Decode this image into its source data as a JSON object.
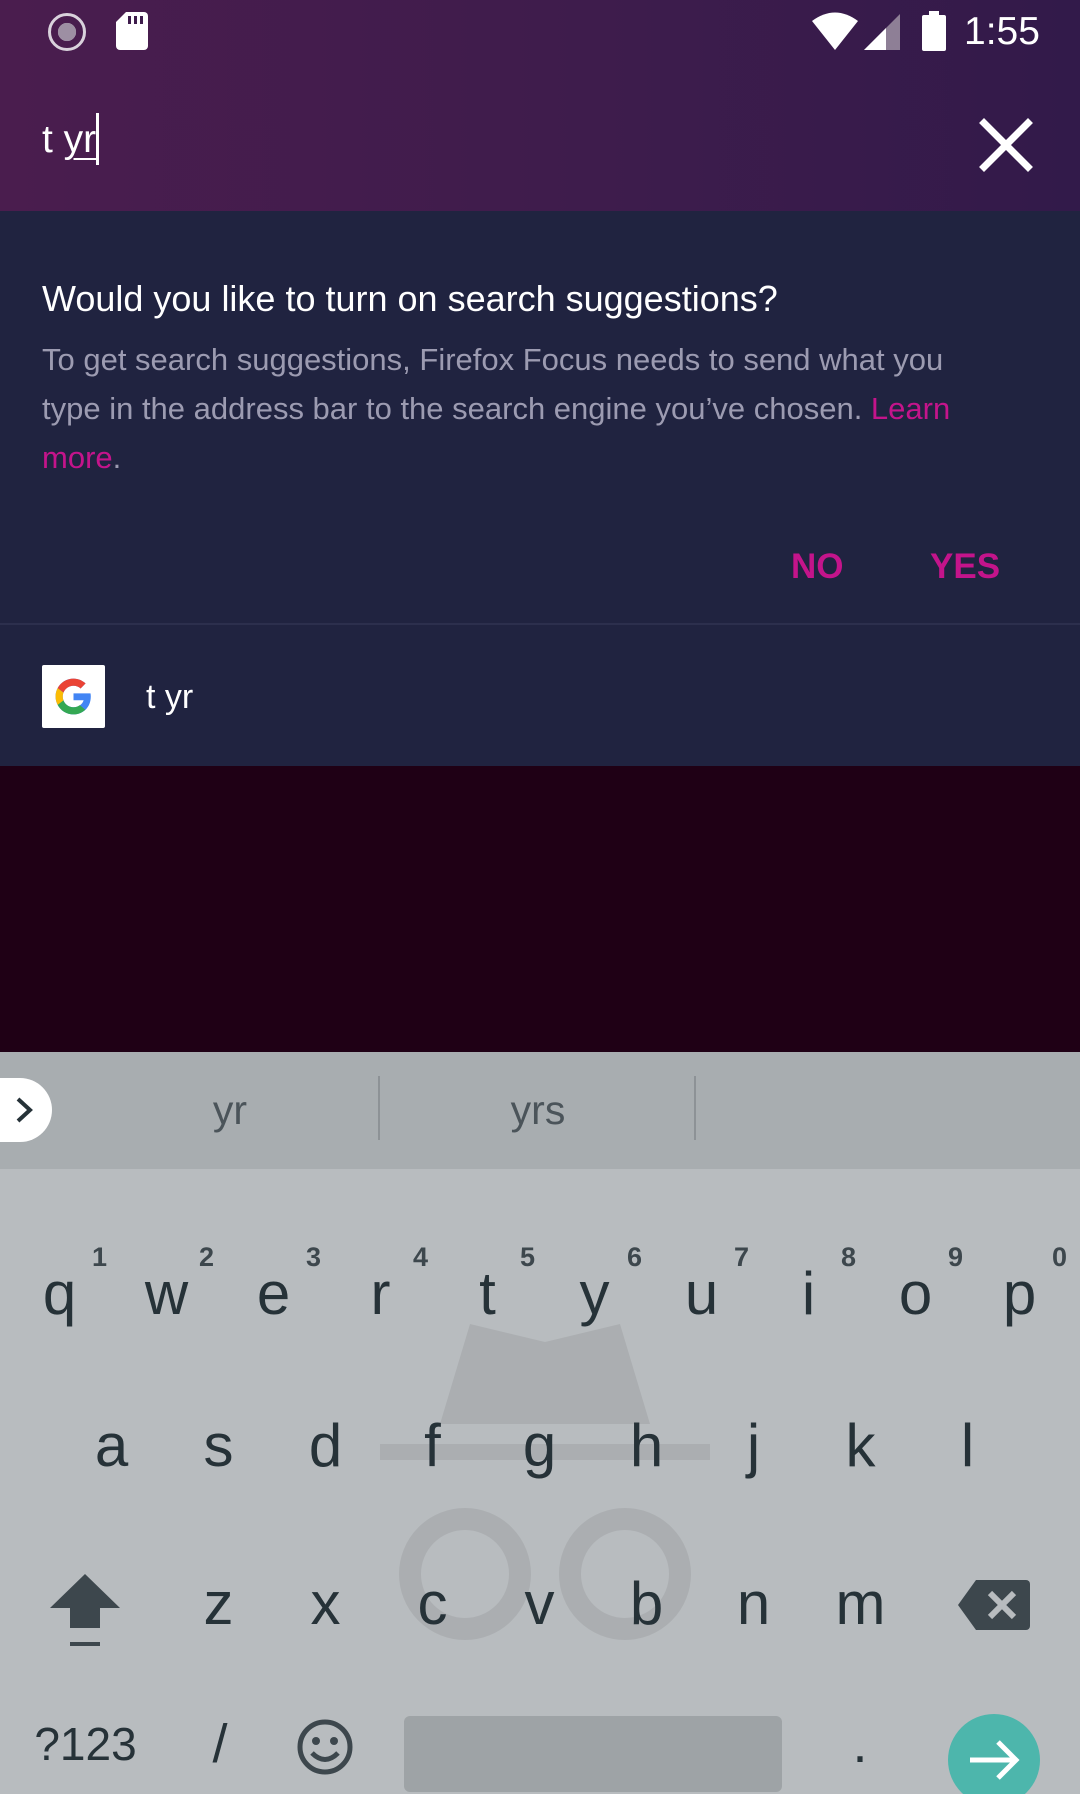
{
  "status_bar": {
    "time": "1:55",
    "icons": [
      "loading-icon",
      "sd-card-icon",
      "wifi-icon",
      "cell-signal-icon",
      "battery-icon"
    ]
  },
  "url_bar": {
    "value": "t yr",
    "value_plain": "t ",
    "value_composing": "yr",
    "clear_icon": "close-icon"
  },
  "suggestion_prompt": {
    "title": "Would you like to turn on search suggestions?",
    "body": "To get search suggestions, Firefox Focus needs to send what you type in the address bar to the search engine you’ve chosen. ",
    "learn_more": "Learn more",
    "period": ".",
    "no_label": "NO",
    "yes_label": "YES"
  },
  "search_row": {
    "engine_icon": "google-icon",
    "query": "t yr"
  },
  "keyboard": {
    "suggestions": [
      "yr",
      "yrs"
    ],
    "row1": [
      {
        "key": "q",
        "hint": "1"
      },
      {
        "key": "w",
        "hint": "2"
      },
      {
        "key": "e",
        "hint": "3"
      },
      {
        "key": "r",
        "hint": "4"
      },
      {
        "key": "t",
        "hint": "5"
      },
      {
        "key": "y",
        "hint": "6"
      },
      {
        "key": "u",
        "hint": "7"
      },
      {
        "key": "i",
        "hint": "8"
      },
      {
        "key": "o",
        "hint": "9"
      },
      {
        "key": "p",
        "hint": "0"
      }
    ],
    "row2": [
      "a",
      "s",
      "d",
      "f",
      "g",
      "h",
      "j",
      "k",
      "l"
    ],
    "row3": [
      "z",
      "x",
      "c",
      "v",
      "b",
      "n",
      "m"
    ],
    "symbols_label": "?123",
    "slash_label": "/",
    "period_label": ".",
    "accent_color": "#4db6ac"
  },
  "colors": {
    "accent": "#c4148b",
    "panel": "#202340",
    "background": "#1f0015"
  }
}
